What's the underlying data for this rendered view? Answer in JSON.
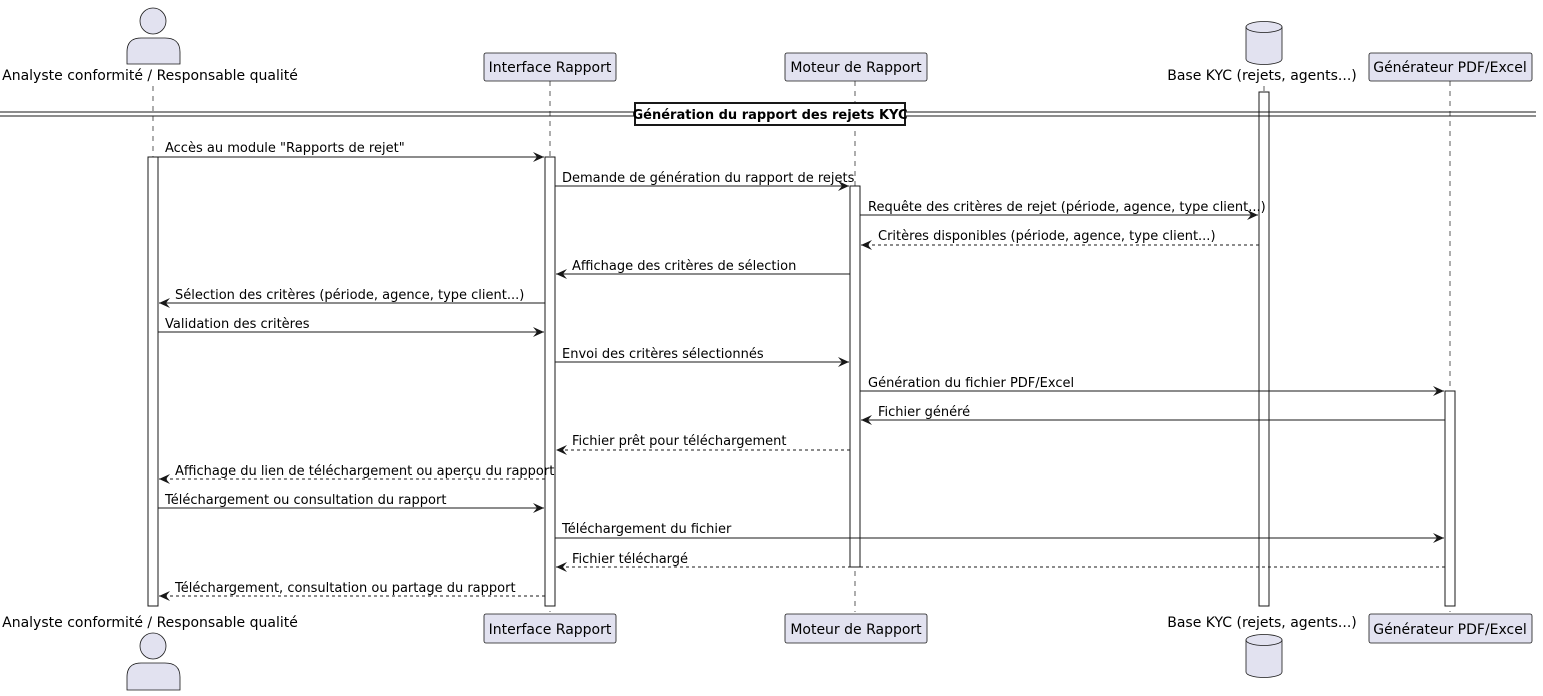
{
  "divider": {
    "label": "Génération du rapport des rejets KYC"
  },
  "participants": [
    {
      "id": "analyste",
      "label": "Analyste conformité / Responsable qualité",
      "kind": "actor"
    },
    {
      "id": "interface",
      "label": "Interface Rapport",
      "kind": "participant"
    },
    {
      "id": "moteur",
      "label": "Moteur de Rapport",
      "kind": "participant"
    },
    {
      "id": "base",
      "label": "Base KYC (rejets, agents...)",
      "kind": "database"
    },
    {
      "id": "generateur",
      "label": "Générateur PDF/Excel",
      "kind": "participant"
    }
  ],
  "messages": [
    {
      "from": "analyste",
      "to": "interface",
      "text": "Accès au module \"Rapports de rejet\"",
      "style": "solid"
    },
    {
      "from": "interface",
      "to": "moteur",
      "text": "Demande de génération du rapport de rejets",
      "style": "solid"
    },
    {
      "from": "moteur",
      "to": "base",
      "text": "Requête des critères de rejet (période, agence, type client...)",
      "style": "solid"
    },
    {
      "from": "base",
      "to": "moteur",
      "text": "Critères disponibles (période, agence, type client...)",
      "style": "dashed"
    },
    {
      "from": "moteur",
      "to": "interface",
      "text": "Affichage des critères de sélection",
      "style": "solid"
    },
    {
      "from": "interface",
      "to": "analyste",
      "text": "Sélection des critères (période, agence, type client...)",
      "style": "solid"
    },
    {
      "from": "analyste",
      "to": "interface",
      "text": "Validation des critères",
      "style": "solid"
    },
    {
      "from": "interface",
      "to": "moteur",
      "text": "Envoi des critères sélectionnés",
      "style": "solid"
    },
    {
      "from": "moteur",
      "to": "generateur",
      "text": "Génération du fichier PDF/Excel",
      "style": "solid"
    },
    {
      "from": "generateur",
      "to": "moteur",
      "text": "Fichier généré",
      "style": "solid"
    },
    {
      "from": "moteur",
      "to": "interface",
      "text": "Fichier prêt pour téléchargement",
      "style": "dashed"
    },
    {
      "from": "interface",
      "to": "analyste",
      "text": "Affichage du lien de téléchargement ou aperçu du rapport",
      "style": "dashed"
    },
    {
      "from": "analyste",
      "to": "interface",
      "text": "Téléchargement ou consultation du rapport",
      "style": "solid"
    },
    {
      "from": "interface",
      "to": "generateur",
      "text": "Téléchargement du fichier",
      "style": "solid"
    },
    {
      "from": "generateur",
      "to": "interface",
      "text": "Fichier téléchargé",
      "style": "dashed"
    },
    {
      "from": "interface",
      "to": "analyste",
      "text": "Téléchargement, consultation ou partage du rapport",
      "style": "dashed"
    }
  ],
  "colors": {
    "participant_fill": "#e2e2f0",
    "participant_stroke": "#181818",
    "lifeline": "#181818",
    "activation_fill": "#ffffff",
    "arrow": "#181818",
    "background": "#ffffff"
  }
}
